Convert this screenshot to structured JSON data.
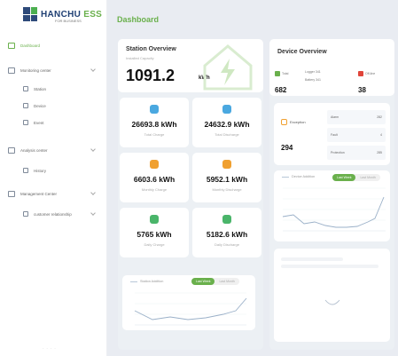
{
  "brand": {
    "name_main": "HANCHU",
    "name_accent": "ESS",
    "tagline": "FOR BUSINESS"
  },
  "sidebar": {
    "items": [
      {
        "label": "Dashboard",
        "active": true,
        "icon": "dashboard-icon"
      },
      {
        "label": "Monitoring center",
        "icon": "monitor-icon",
        "expandable": true
      },
      {
        "label": "Station",
        "icon": "station-icon",
        "sub": true
      },
      {
        "label": "Device",
        "icon": "device-icon",
        "sub": true
      },
      {
        "label": "Event",
        "icon": "event-icon",
        "sub": true
      },
      {
        "label": "Analysis center",
        "icon": "analysis-icon",
        "expandable": true
      },
      {
        "label": "History",
        "icon": "history-icon",
        "sub": true
      },
      {
        "label": "Management Center",
        "icon": "management-icon",
        "expandable": true
      },
      {
        "label": "customer relationship",
        "icon": "customer-icon",
        "sub": true,
        "expandable": true
      }
    ],
    "footer": "- - - -"
  },
  "page": {
    "title": "Dashboard"
  },
  "station": {
    "title": "Station Overview",
    "subtitle": "Installed Capacity",
    "capacity_value": "1091.2",
    "capacity_unit": "kWh",
    "metrics": [
      {
        "value": "26693.8 kWh",
        "label": "Total Charge",
        "color": "#4aa8e0"
      },
      {
        "value": "24632.9 kWh",
        "label": "Total Discharge",
        "color": "#4aa8e0"
      },
      {
        "value": "6603.6 kWh",
        "label": "Monthly Charge",
        "color": "#f0a030"
      },
      {
        "value": "5952.1 kWh",
        "label": "Monthly Discharge",
        "color": "#f0a030"
      },
      {
        "value": "5765 kWh",
        "label": "Daily Charge",
        "color": "#4ab56a"
      },
      {
        "value": "5182.6 kWh",
        "label": "Daily Discharge",
        "color": "#4ab56a"
      }
    ],
    "chart": {
      "legend": "Station Addition",
      "toggle_on": "Last Week",
      "toggle_off": "Last Month"
    }
  },
  "device": {
    "title": "Device Overview",
    "total_label": "Total",
    "total_value": "682",
    "logger_label": "Logger",
    "logger_value": "341",
    "battery_label": "Battery",
    "battery_value": "341",
    "offline_label": "Off-line",
    "offline_value": "38",
    "exception_label": "Exception",
    "exception_value": "294",
    "exception_rows": [
      {
        "label": "Alarm",
        "value": "282"
      },
      {
        "label": "Fault",
        "value": "4"
      },
      {
        "label": "Protection",
        "value": "285"
      }
    ],
    "chart": {
      "legend": "Device Addition",
      "toggle_on": "Last Week",
      "toggle_off": "Last Month"
    }
  },
  "colors": {
    "accent": "#6ab04c",
    "offline": "#e0453a",
    "exception": "#f0a030",
    "chart_line": "#9ab0c8"
  }
}
